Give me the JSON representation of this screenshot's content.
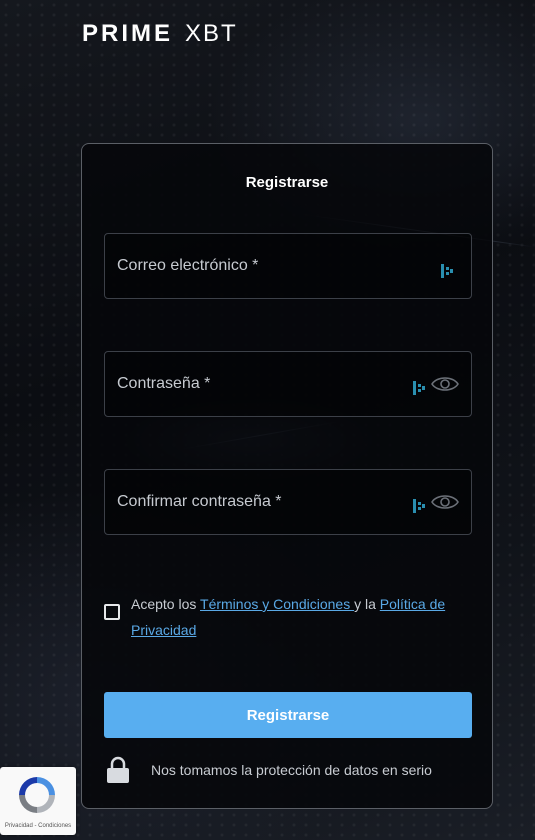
{
  "brand": {
    "prime": "PRIME",
    "xbt": "XBT"
  },
  "form": {
    "title": "Registrarse",
    "email_placeholder": "Correo electrónico *",
    "password_placeholder": "Contraseña *",
    "confirm_placeholder": "Confirmar contraseña *",
    "terms": {
      "prefix": "Acepto los ",
      "terms_link": "Términos y Condiciones ",
      "middle": "y la ",
      "privacy_link": "Política de Privacidad"
    },
    "submit_label": "Registrarse",
    "security_note": "Nos tomamos la protección de datos en serio"
  },
  "recaptcha": {
    "links": "Privacidad - Condiciones"
  },
  "colors": {
    "accent": "#58aef0",
    "link": "#5aa9e6",
    "card_border": "#5b5f66",
    "password_manager_icon": "#2a8fb0"
  },
  "icons": [
    "password-manager-icon",
    "eye-icon",
    "lock-icon",
    "recaptcha-icon"
  ]
}
